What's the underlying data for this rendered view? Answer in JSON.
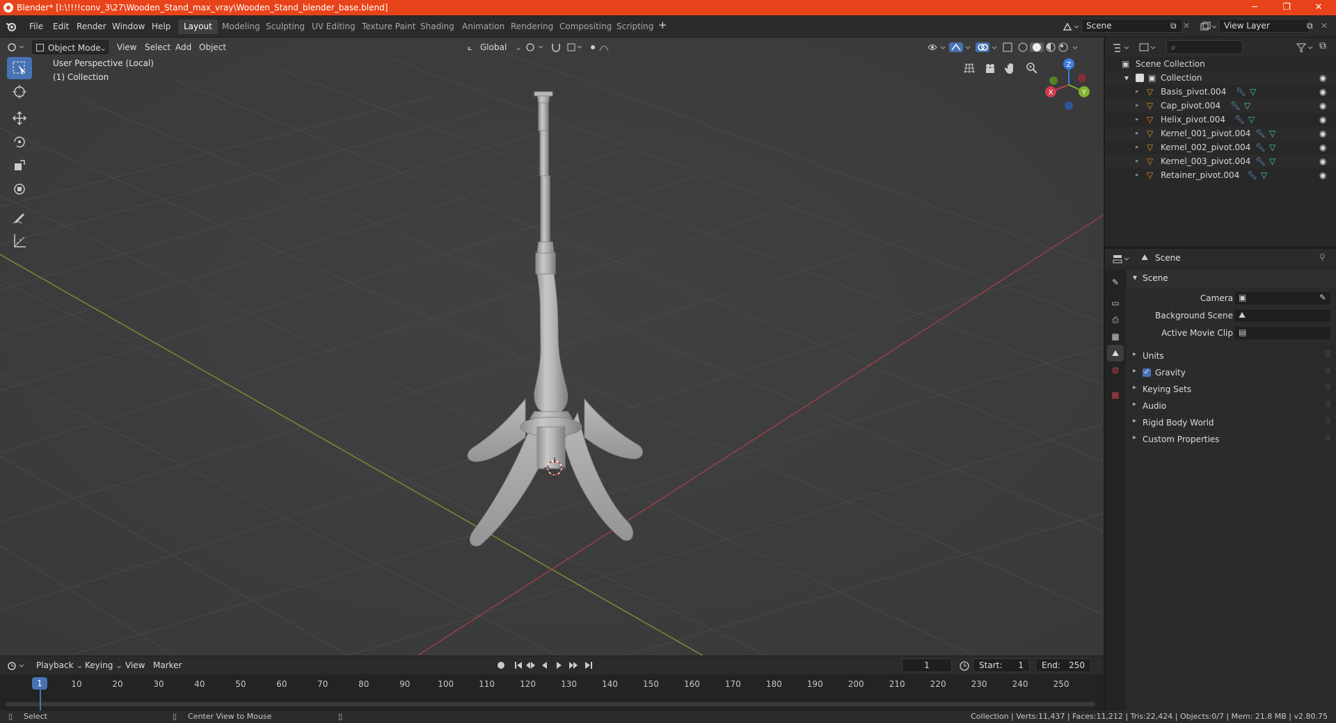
{
  "window": {
    "title": "Blender* [I:\\!!!!conv_3\\27\\Wooden_Stand_max_vray\\Wooden_Stand_blender_base.blend]",
    "minimize": "─",
    "restore": "❐",
    "close": "✕"
  },
  "menu": {
    "file": "File",
    "edit": "Edit",
    "render": "Render",
    "window": "Window",
    "help": "Help"
  },
  "workspaces": [
    "Layout",
    "Modeling",
    "Sculpting",
    "UV Editing",
    "Texture Paint",
    "Shading",
    "Animation",
    "Rendering",
    "Compositing",
    "Scripting"
  ],
  "scene_field": "Scene",
  "view_layer_field": "View Layer",
  "viewport": {
    "mode": "Object Mode",
    "menus": [
      "View",
      "Select",
      "Add",
      "Object"
    ],
    "orientation": "Global",
    "overlay_title": "User Perspective (Local)",
    "overlay_collection": "(1) Collection",
    "gizmo": {
      "z": "Z",
      "x": "X",
      "y": "Y"
    }
  },
  "timeline": {
    "menus": [
      "Playback",
      "Keying",
      "View",
      "Marker"
    ],
    "current_frame": "1",
    "start_label": "Start:",
    "start_value": "1",
    "end_label": "End:",
    "end_value": "250",
    "ticks": [
      "1",
      "10",
      "20",
      "30",
      "40",
      "50",
      "60",
      "70",
      "80",
      "90",
      "100",
      "110",
      "120",
      "130",
      "140",
      "150",
      "160",
      "170",
      "180",
      "190",
      "200",
      "210",
      "220",
      "230",
      "240",
      "250"
    ]
  },
  "outliner": {
    "scene_collection": "Scene Collection",
    "collection": "Collection",
    "objects": [
      "Basis_pivot.004",
      "Cap_pivot.004",
      "Helix_pivot.004",
      "Kernel_001_pivot.004",
      "Kernel_002_pivot.004",
      "Kernel_003_pivot.004",
      "Retainer_pivot.004"
    ]
  },
  "properties": {
    "context": "Scene",
    "panel": "Scene",
    "camera_label": "Camera",
    "background_scene_label": "Background Scene",
    "active_movie_clip_label": "Active Movie Clip",
    "sections": [
      "Units",
      "Gravity",
      "Keying Sets",
      "Audio",
      "Rigid Body World",
      "Custom Properties"
    ],
    "gravity_checked": true
  },
  "status": {
    "select": "Select",
    "center_view": "Center View to Mouse",
    "stats": "Collection | Verts:11,437 | Faces:11,212 | Tris:22,424 | Objects:0/7 | Mem: 21.8 MB | v2.80.75"
  },
  "colors": {
    "titlebar": "#e8431a",
    "accent": "#4772b3",
    "axis_x": "#c8414f",
    "axis_y": "#7fa53a",
    "mesh_icon": "#e8902a"
  }
}
